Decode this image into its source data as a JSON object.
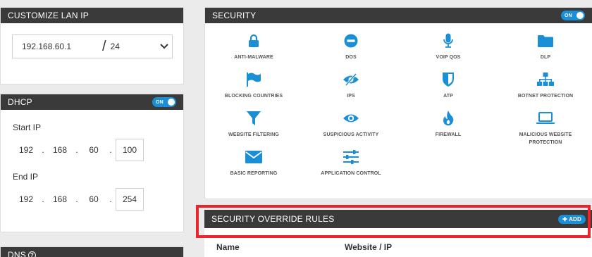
{
  "lan": {
    "title": "CUSTOMIZE LAN IP",
    "ip": "192.168.60.1",
    "slash": "/",
    "mask": "24"
  },
  "dhcp": {
    "title": "DHCP",
    "toggle": "ON",
    "start_label": "Start IP",
    "start": [
      "192",
      "168",
      "60",
      "100"
    ],
    "end_label": "End IP",
    "end": [
      "192",
      "168",
      "60",
      "254"
    ]
  },
  "dns": {
    "title": "DNS"
  },
  "security": {
    "title": "SECURITY",
    "toggle": "ON",
    "items": [
      {
        "label": "ANTI-MALWARE",
        "icon": "lock-icon"
      },
      {
        "label": "DOS",
        "icon": "no-entry-icon"
      },
      {
        "label": "VOIP QOS",
        "icon": "microphone-icon"
      },
      {
        "label": "DLP",
        "icon": "folder-icon"
      },
      {
        "label": "BLOCKING COUNTRIES",
        "icon": "flag-icon"
      },
      {
        "label": "IPS",
        "icon": "eye-slash-icon"
      },
      {
        "label": "ATP",
        "icon": "shield-icon"
      },
      {
        "label": "BOTNET PROTECTION",
        "icon": "sitemap-icon"
      },
      {
        "label": "WEBSITE FILTERING",
        "icon": "filter-icon"
      },
      {
        "label": "SUSPICIOUS ACTIVITY",
        "icon": "eye-icon"
      },
      {
        "label": "FIREWALL",
        "icon": "fire-icon"
      },
      {
        "label": "MALICIOUS WEBSITE PROTECTION",
        "icon": "laptop-icon"
      },
      {
        "label": "BASIC REPORTING",
        "icon": "envelope-icon"
      },
      {
        "label": "APPLICATION CONTROL",
        "icon": "sliders-icon"
      }
    ]
  },
  "override": {
    "title": "SECURITY OVERRIDE RULES",
    "add_label": "ADD",
    "columns": [
      "Name",
      "Website / IP"
    ]
  },
  "colors": {
    "accent": "#1a8fd6",
    "header": "#3a3a3a",
    "highlight": "#e8262b"
  }
}
